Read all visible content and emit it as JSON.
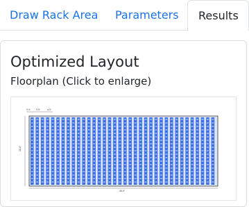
{
  "tabs": [
    {
      "label": "Draw Rack Area",
      "active": false
    },
    {
      "label": "Parameters",
      "active": false
    },
    {
      "label": "Results",
      "active": true
    }
  ],
  "card": {
    "title": "Optimized Layout",
    "subtitle": "Floorplan (Click to enlarge)"
  },
  "colors": {
    "accent": "#1a73e8",
    "rack_blue": "#3f6fe0",
    "rack_light": "#8fb0f5"
  },
  "floorplan": {
    "dim_labels": [
      "5.5'",
      "3.5'",
      "4.5'"
    ],
    "bottom_label": "40.0'",
    "side_label": "10.0'"
  }
}
